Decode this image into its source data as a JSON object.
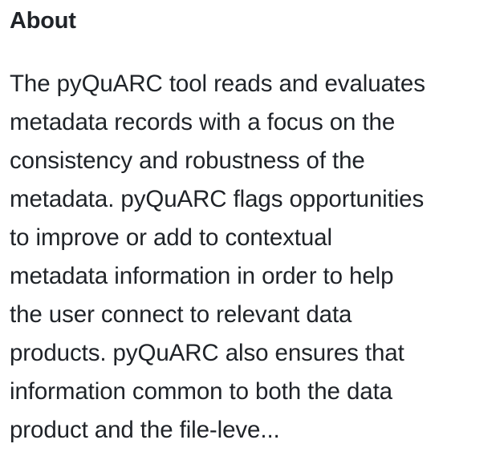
{
  "about": {
    "heading": "About",
    "description_lines": [
      "The pyQuARC tool reads and evaluates",
      "metadata records with a focus on the",
      "consistency and robustness of the",
      "metadata. pyQuARC flags opportunities",
      "to improve or add to contextual",
      "metadata information in order to help",
      "the user connect to relevant data",
      "products. pyQuARC also ensures that",
      "information common to both the data",
      "product and the file-leve..."
    ]
  }
}
